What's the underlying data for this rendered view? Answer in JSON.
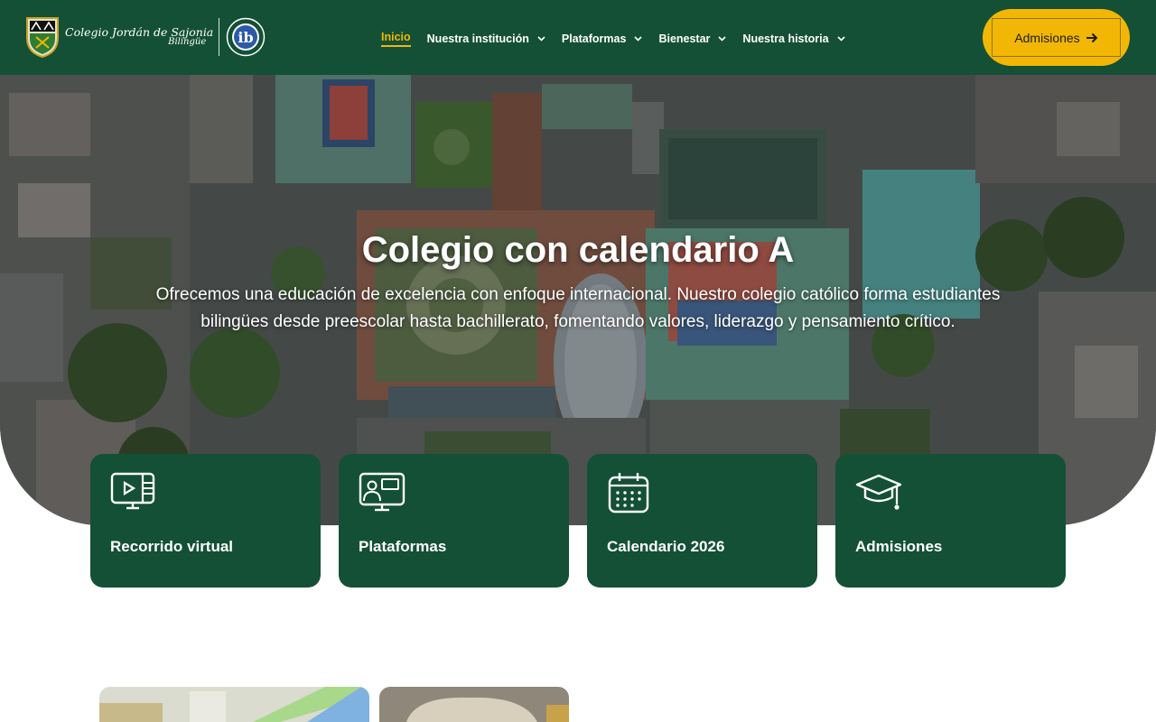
{
  "header": {
    "logo_line1": "Colegio Jordán de Sajonia",
    "logo_line2": "Bilingüe",
    "ib_label": "ib",
    "nav": [
      {
        "label": "Inicio",
        "active": true,
        "dropdown": false
      },
      {
        "label": "Nuestra institución",
        "active": false,
        "dropdown": true
      },
      {
        "label": "Plataformas",
        "active": false,
        "dropdown": true
      },
      {
        "label": "Bienestar",
        "active": false,
        "dropdown": true
      },
      {
        "label": "Nuestra historia",
        "active": false,
        "dropdown": true
      }
    ],
    "cta_label": "Admisiones",
    "cta_icon": "arrow-right-icon"
  },
  "hero": {
    "title": "Colegio con calendario A",
    "subtitle": "Ofrecemos una educación de excelencia con enfoque internacional. Nuestro colegio católico forma estudiantes bilingües desde preescolar hasta bachillerato, fomentando valores, liderazgo y pensamiento crítico."
  },
  "cards": [
    {
      "label": "Recorrido virtual",
      "icon": "video-monitor-icon"
    },
    {
      "label": "Plataformas",
      "icon": "presentation-monitor-icon"
    },
    {
      "label": "Calendario 2026",
      "icon": "calendar-icon"
    },
    {
      "label": "Admisiones",
      "icon": "graduation-cap-icon"
    }
  ],
  "colors": {
    "brand_green": "#145035",
    "accent_yellow": "#f2b705",
    "white": "#ffffff"
  }
}
